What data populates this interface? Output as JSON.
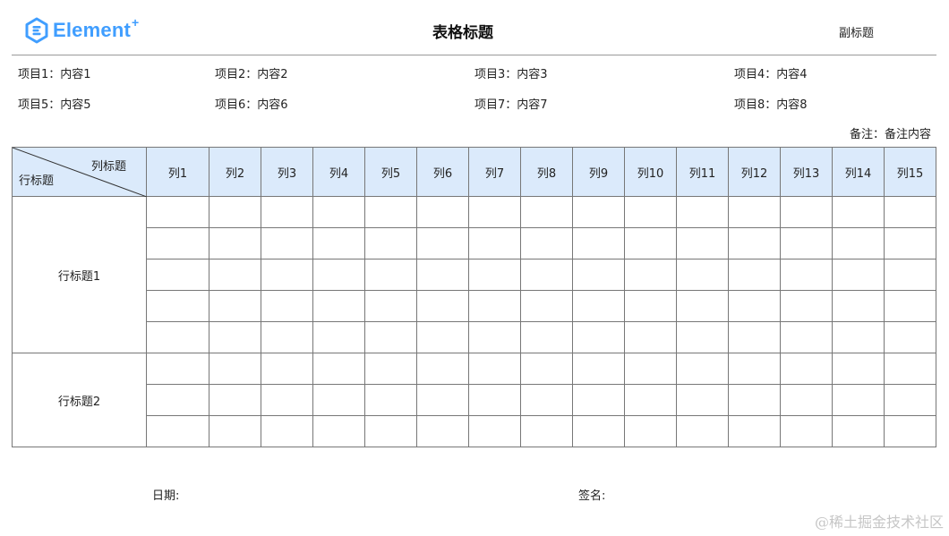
{
  "brand": {
    "name": "Element",
    "plus": "+",
    "color": "#409eff"
  },
  "header": {
    "title": "表格标题",
    "subtitle": "副标题"
  },
  "info_items": [
    "项目1：内容1",
    "项目2：内容2",
    "项目3：内容3",
    "项目4：内容4",
    "项目5：内容5",
    "项目6：内容6",
    "项目7：内容7",
    "项目8：内容8"
  ],
  "remark": "备注：备注内容",
  "table": {
    "corner": {
      "column_title": "列标题",
      "row_title": "行标题"
    },
    "columns": [
      "列1",
      "列2",
      "列3",
      "列4",
      "列5",
      "列6",
      "列7",
      "列8",
      "列9",
      "列10",
      "列11",
      "列12",
      "列13",
      "列14",
      "列15"
    ],
    "row_groups": [
      {
        "label": "行标题1",
        "rows": 5
      },
      {
        "label": "行标题2",
        "rows": 3
      }
    ],
    "header_bg": "#dbeafb",
    "border_color": "#777777"
  },
  "footer": {
    "date_label": "日期:",
    "signature_label": "签名:"
  },
  "watermark": "@稀土掘金技术社区"
}
